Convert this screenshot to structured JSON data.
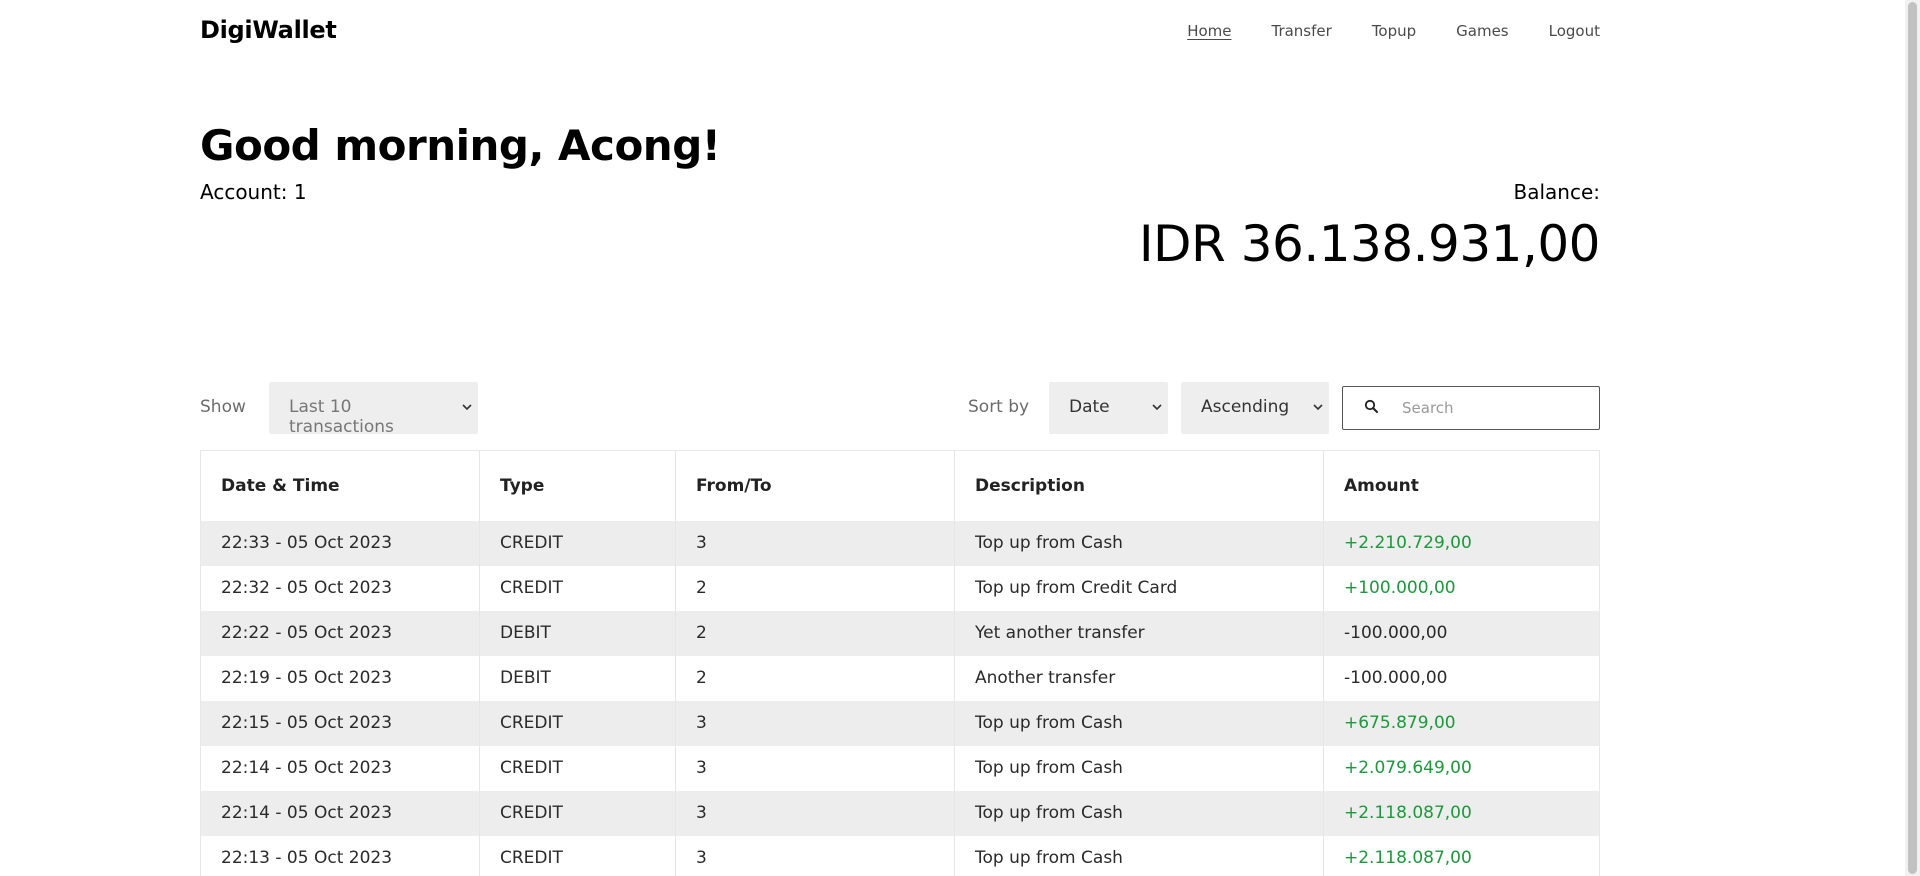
{
  "nav": {
    "brand": "DigiWallet",
    "links": [
      "Home",
      "Transfer",
      "Topup",
      "Games",
      "Logout"
    ]
  },
  "header": {
    "greeting": "Good morning, Acong!",
    "account": "Account: 1",
    "balance_label": "Balance:",
    "balance_value": "IDR 36.138.931,00"
  },
  "controls": {
    "show_label": "Show",
    "show_value": "Last 10 transactions",
    "sortby_label": "Sort by",
    "sort_value": "Date",
    "order_value": "Ascending",
    "search_placeholder": "Search"
  },
  "table": {
    "columns": [
      "Date & Time",
      "Type",
      "From/To",
      "Description",
      "Amount"
    ],
    "rows": [
      [
        "22:33 - 05 Oct 2023",
        "CREDIT",
        "3",
        "Top up from Cash",
        "+2.210.729,00"
      ],
      [
        "22:32 - 05 Oct 2023",
        "CREDIT",
        "2",
        "Top up from Credit Card",
        "+100.000,00"
      ],
      [
        "22:22 - 05 Oct 2023",
        "DEBIT",
        "2",
        "Yet another transfer",
        "-100.000,00"
      ],
      [
        "22:19 - 05 Oct 2023",
        "DEBIT",
        "2",
        "Another transfer",
        "-100.000,00"
      ],
      [
        "22:15 - 05 Oct 2023",
        "CREDIT",
        "3",
        "Top up from Cash",
        "+675.879,00"
      ],
      [
        "22:14 - 05 Oct 2023",
        "CREDIT",
        "3",
        "Top up from Cash",
        "+2.079.649,00"
      ],
      [
        "22:14 - 05 Oct 2023",
        "CREDIT",
        "3",
        "Top up from Cash",
        "+2.118.087,00"
      ],
      [
        "22:13 - 05 Oct 2023",
        "CREDIT",
        "3",
        "Top up from Cash",
        "+2.118.087,00"
      ]
    ]
  },
  "colors": {
    "credit": "#1a9a3a",
    "debit": "#2a2a2a",
    "row_alt": "#ededed"
  },
  "icons": {
    "search": "search-icon",
    "chevron": "chevron-down-icon"
  }
}
